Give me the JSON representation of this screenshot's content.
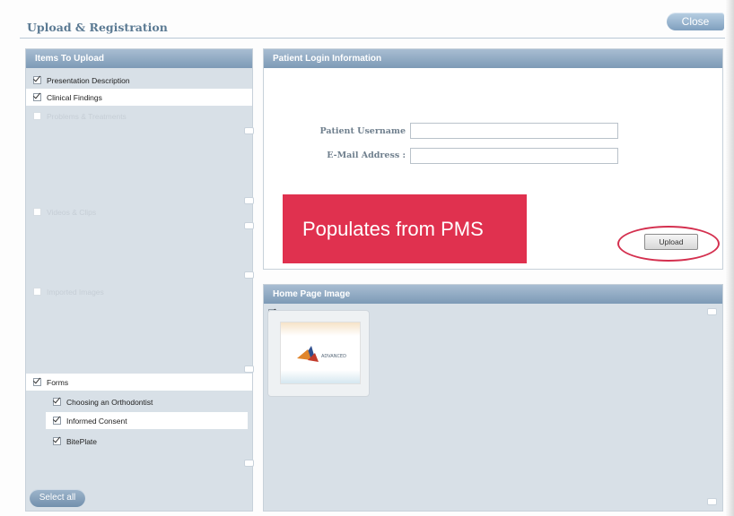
{
  "window": {
    "title": "Upload & Registration",
    "close_label": "Close"
  },
  "items_panel": {
    "header": "Items To Upload",
    "items": [
      {
        "label": "Presentation Description",
        "checked": true,
        "enabled": true
      },
      {
        "label": "Clinical Findings",
        "checked": true,
        "enabled": true
      },
      {
        "label": "Problems & Treatments",
        "checked": false,
        "enabled": false
      },
      {
        "label": "Videos & Clips",
        "checked": false,
        "enabled": false
      },
      {
        "label": "Imported Images",
        "checked": false,
        "enabled": false
      },
      {
        "label": "Forms",
        "checked": true,
        "enabled": true
      }
    ],
    "form_items": [
      {
        "label": "Choosing an Orthodontist",
        "checked": true
      },
      {
        "label": "Informed Consent",
        "checked": true
      },
      {
        "label": "BitePlate",
        "checked": true
      }
    ],
    "select_all_label": "Select all"
  },
  "login_panel": {
    "header": "Patient Login Information",
    "username_label": "Patient Username",
    "username_value": "",
    "email_label": "E-Mail Address :",
    "email_value": "",
    "upload_label": "Upload",
    "callout_text": "Populates from PMS"
  },
  "home_image_panel": {
    "header": "Home Page Image",
    "image_checked": true,
    "thumbnail_caption": "ADVANCED"
  },
  "colors": {
    "header_blue": "#7d9ab6",
    "callout_red": "#e0314f",
    "panel_bg": "#d8e0e7"
  }
}
